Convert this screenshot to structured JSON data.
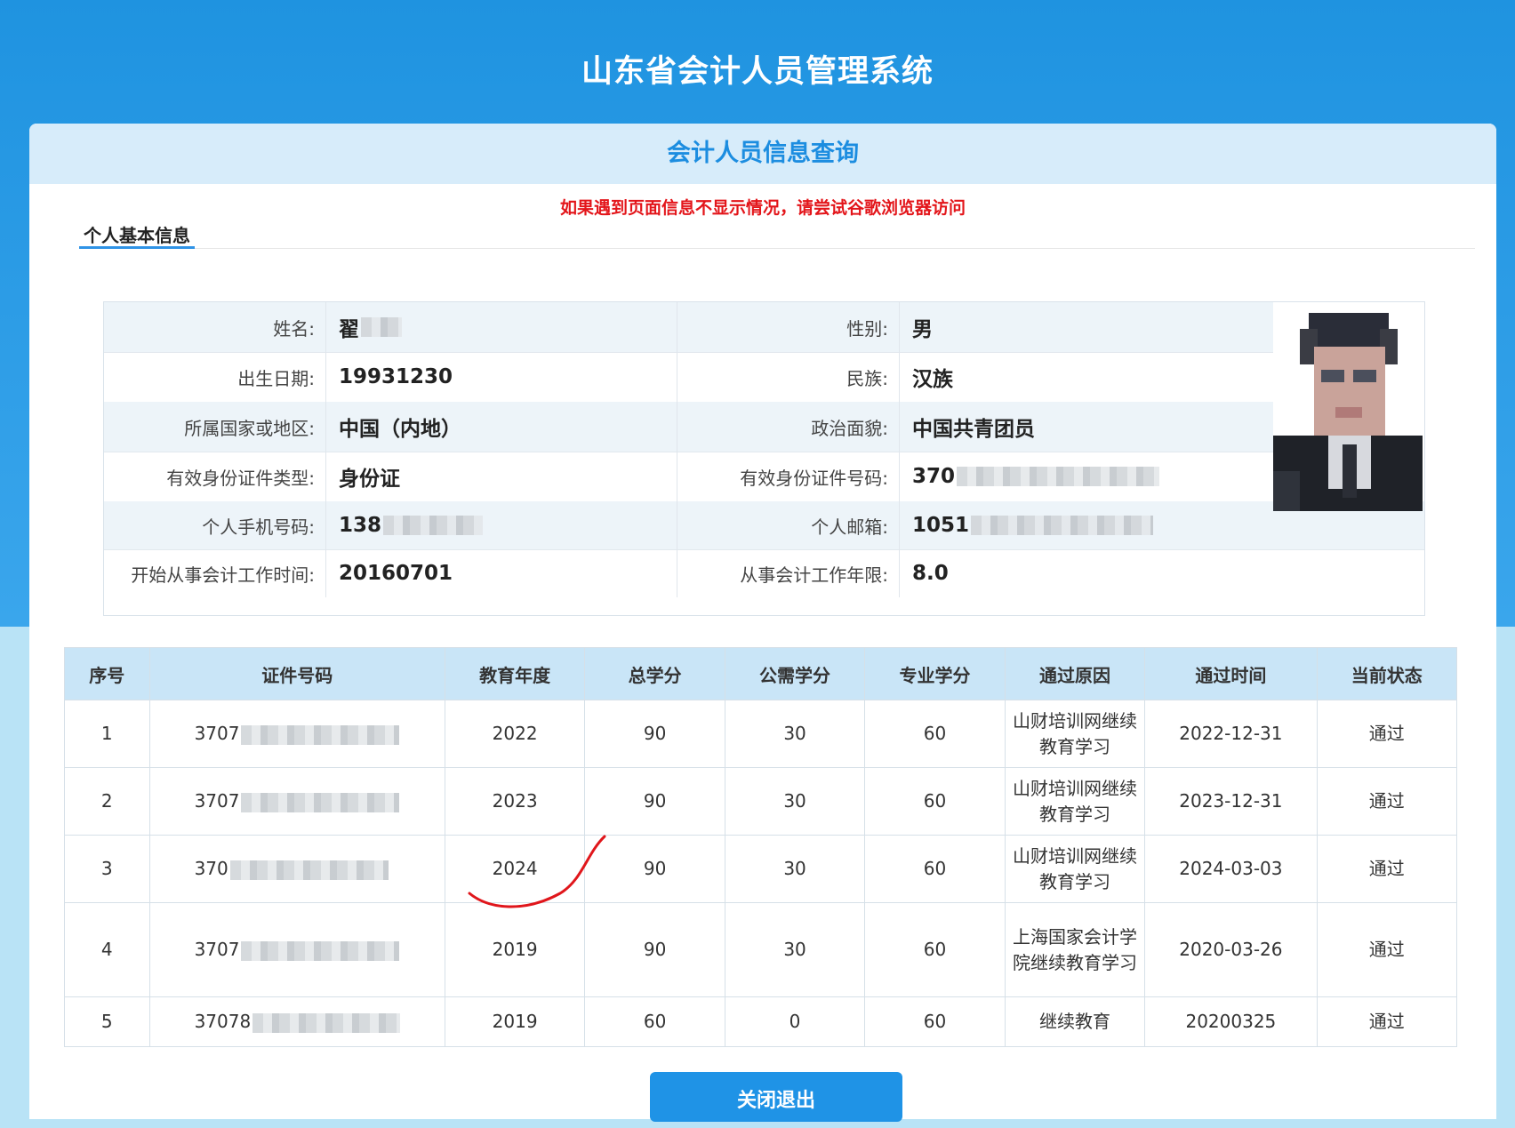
{
  "system_title": "山东省会计人员管理系统",
  "panel_title": "会计人员信息查询",
  "notice": "如果遇到页面信息不显示情况，请尝试谷歌浏览器访问",
  "tab_label": "个人基本信息",
  "info": {
    "name_label": "姓名:",
    "name_value": "翟",
    "gender_label": "性别:",
    "gender_value": "男",
    "birth_label": "出生日期:",
    "birth_value": "19931230",
    "ethnic_label": "民族:",
    "ethnic_value": "汉族",
    "region_label": "所属国家或地区:",
    "region_value": "中国（内地）",
    "political_label": "政治面貌:",
    "political_value": "中国共青团员",
    "idtype_label": "有效身份证件类型:",
    "idtype_value": "身份证",
    "idno_label": "有效身份证件号码:",
    "idno_value": "370",
    "phone_label": "个人手机号码:",
    "phone_value": "138",
    "email_label": "个人邮箱:",
    "email_value": "1051",
    "start_label": "开始从事会计工作时间:",
    "start_value": "20160701",
    "years_label": "从事会计工作年限:",
    "years_value": "8.0"
  },
  "table": {
    "headers": [
      "序号",
      "证件号码",
      "教育年度",
      "总学分",
      "公需学分",
      "专业学分",
      "通过原因",
      "通过时间",
      "当前状态"
    ],
    "rows": [
      [
        "1",
        "3707",
        "2022",
        "90",
        "30",
        "60",
        "山财培训网继续教育学习",
        "2022-12-31",
        "通过"
      ],
      [
        "2",
        "3707",
        "2023",
        "90",
        "30",
        "60",
        "山财培训网继续教育学习",
        "2023-12-31",
        "通过"
      ],
      [
        "3",
        "370",
        "2024",
        "90",
        "30",
        "60",
        "山财培训网继续教育学习",
        "2024-03-03",
        "通过"
      ],
      [
        "4",
        "3707",
        "2019",
        "90",
        "30",
        "60",
        "上海国家会计学院继续教育学习",
        "2020-03-26",
        "通过"
      ],
      [
        "5",
        "37078",
        "2019",
        "60",
        "0",
        "60",
        "继续教育",
        "20200325",
        "通过"
      ]
    ]
  },
  "close_button": "关闭退出",
  "colors": {
    "header_blue": "#1f93e0",
    "accent": "#1c8de0",
    "notice_red": "#e3151a",
    "annotation_red": "#e0161b"
  }
}
